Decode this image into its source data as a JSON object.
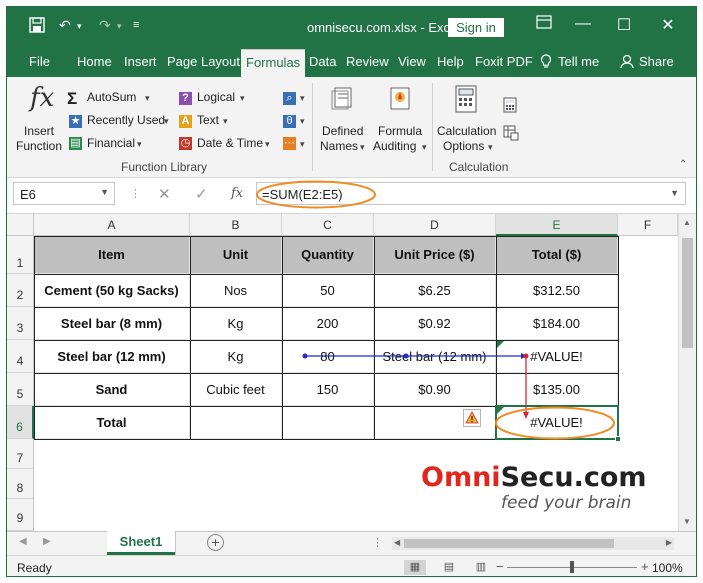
{
  "window": {
    "title": "omnisecu.com.xlsx  -  Excel",
    "signin_label": "Sign in",
    "icons": [
      "save-icon",
      "undo-icon",
      "redo-icon",
      "customize-quick-access-icon",
      "ribbon-display-icon",
      "minimize-icon",
      "maximize-icon",
      "close-icon"
    ]
  },
  "tabs": [
    "File",
    "Home",
    "Insert",
    "Page Layout",
    "Formulas",
    "Data",
    "Review",
    "View",
    "Help",
    "Foxit PDF",
    "Tell me",
    "Share"
  ],
  "ribbon": {
    "insert_function": [
      "Insert",
      "Function"
    ],
    "autosum": "AutoSum",
    "recently_used": "Recently Used",
    "financial": "Financial",
    "logical": "Logical",
    "text": "Text",
    "date_time": "Date & Time",
    "defined_names": [
      "Defined",
      "Names"
    ],
    "formula_auditing": [
      "Formula",
      "Auditing"
    ],
    "calculation_options": [
      "Calculation",
      "Options"
    ],
    "group_function_library": "Function Library",
    "group_calculation": "Calculation"
  },
  "formula_bar": {
    "name_box": "E6",
    "formula": "=SUM(E2:E5)"
  },
  "columns": [
    "A",
    "B",
    "C",
    "D",
    "E",
    "F"
  ],
  "rows": [
    "1",
    "2",
    "3",
    "4",
    "5",
    "6",
    "7",
    "8",
    "9"
  ],
  "table": {
    "header": [
      "Item",
      "Unit",
      "Quantity",
      "Unit Price ($)",
      "Total ($)"
    ],
    "rows": [
      [
        "Cement (50 kg Sacks)",
        "Nos",
        "50",
        "$6.25",
        "$312.50"
      ],
      [
        "Steel bar (8 mm)",
        "Kg",
        "200",
        "$0.92",
        "$184.00"
      ],
      [
        "Steel bar (12 mm)",
        "Kg",
        "80",
        "Steel bar (12 mm)",
        "#VALUE!"
      ],
      [
        "Sand",
        "Cubic feet",
        "150",
        "$0.90",
        "$135.00"
      ],
      [
        "Total",
        "",
        "",
        "",
        "#VALUE!"
      ]
    ]
  },
  "logo": {
    "main_left": "Omni",
    "main_right": "Secu.com",
    "tagline": "feed your brain"
  },
  "sheet_tab": "Sheet1",
  "status": {
    "ready": "Ready",
    "zoom": "100%"
  },
  "colors": {
    "excel_green": "#217346",
    "logo_red": "#e3261c",
    "header_gray": "#bfbfbf",
    "annotation_orange": "#f18b26",
    "trace_blue": "#1f2bd1",
    "trace_red": "#d9252a"
  }
}
